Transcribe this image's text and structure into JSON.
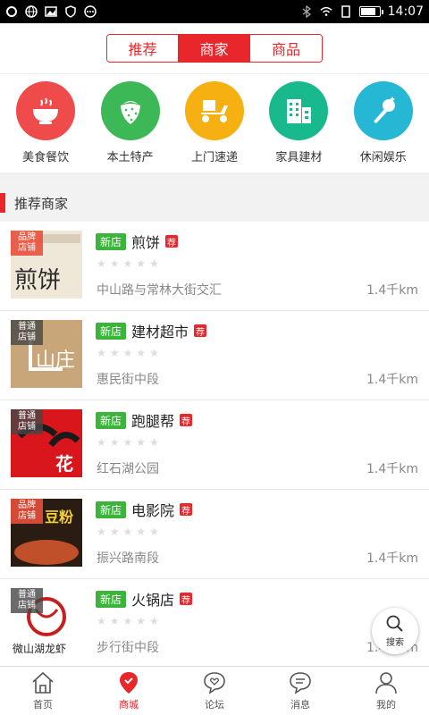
{
  "status": {
    "time": "14:07",
    "battery_level": 0.85
  },
  "tabs": [
    {
      "label": "推荐",
      "active": false
    },
    {
      "label": "商家",
      "active": true
    },
    {
      "label": "商品",
      "active": false
    }
  ],
  "categories": [
    {
      "label": "美食餐饮",
      "icon": "bowl-icon",
      "color": "#ef4b4b"
    },
    {
      "label": "本土特产",
      "icon": "strawberry-icon",
      "color": "#3cb856"
    },
    {
      "label": "上门速递",
      "icon": "scooter-icon",
      "color": "#f6b012"
    },
    {
      "label": "家具建材",
      "icon": "building-icon",
      "color": "#19b98e"
    },
    {
      "label": "休闲娱乐",
      "icon": "microphone-icon",
      "color": "#25b7d3"
    }
  ],
  "section": {
    "title": "推荐商家"
  },
  "stores": [
    {
      "tag": "品牌\n店铺",
      "badge_new": "新店",
      "name": "煎饼",
      "badge_rec": "荐",
      "address": "中山路与常林大街交汇",
      "distance": "1.4千km",
      "thumb_text": "煎饼"
    },
    {
      "tag": "普通\n店铺",
      "badge_new": "新店",
      "name": "建材超市",
      "badge_rec": "荐",
      "address": "惠民街中段",
      "distance": "1.4千km",
      "thumb_text": "山庄"
    },
    {
      "tag": "普通\n店铺",
      "badge_new": "新店",
      "name": "跑腿帮",
      "badge_rec": "荐",
      "address": "红石湖公园",
      "distance": "1.4千km",
      "thumb_text": "花"
    },
    {
      "tag": "品牌\n店铺",
      "badge_new": "新店",
      "name": "电影院",
      "badge_rec": "荐",
      "address": "振兴路南段",
      "distance": "1.4千km",
      "thumb_text": "豆粉"
    },
    {
      "tag": "普通\n店铺",
      "badge_new": "新店",
      "name": "火锅店",
      "badge_rec": "荐",
      "address": "步行街中段",
      "distance": "1.4千km",
      "thumb_text": "微山湖龙虾"
    }
  ],
  "fab": {
    "label": "搜索"
  },
  "nav": [
    {
      "label": "首页",
      "icon": "home-icon",
      "active": false
    },
    {
      "label": "商城",
      "icon": "location-pin-icon",
      "active": true
    },
    {
      "label": "论坛",
      "icon": "heart-chat-icon",
      "active": false
    },
    {
      "label": "消息",
      "icon": "message-icon",
      "active": false
    },
    {
      "label": "我的",
      "icon": "user-icon",
      "active": false
    }
  ]
}
